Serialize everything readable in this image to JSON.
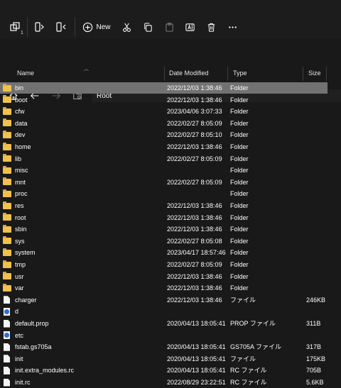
{
  "toolbar": {
    "badge_count": "1",
    "new_label": "New"
  },
  "address": {
    "path": "Root"
  },
  "columns": {
    "name": "Name",
    "date": "Date Modified",
    "type": "Type",
    "size": "Size"
  },
  "files": [
    {
      "name": "bin",
      "date": "2022/12/03 1:38:46",
      "type": "Folder",
      "size": "",
      "icon": "folder-icon",
      "selected": true
    },
    {
      "name": "boot",
      "date": "2022/12/03 1:38:46",
      "type": "Folder",
      "size": "",
      "icon": "folder-icon"
    },
    {
      "name": "cfw",
      "date": "2023/04/06 3:07:33",
      "type": "Folder",
      "size": "",
      "icon": "folder-icon"
    },
    {
      "name": "data",
      "date": "2022/02/27 8:05:09",
      "type": "Folder",
      "size": "",
      "icon": "folder-icon"
    },
    {
      "name": "dev",
      "date": "2022/02/27 8:05:10",
      "type": "Folder",
      "size": "",
      "icon": "folder-icon"
    },
    {
      "name": "home",
      "date": "2022/12/03 1:38:46",
      "type": "Folder",
      "size": "",
      "icon": "folder-icon"
    },
    {
      "name": "lib",
      "date": "2022/02/27 8:05:09",
      "type": "Folder",
      "size": "",
      "icon": "folder-icon"
    },
    {
      "name": "misc",
      "date": "",
      "type": "Folder",
      "size": "",
      "icon": "folder-icon"
    },
    {
      "name": "mnt",
      "date": "2022/02/27 8:05:09",
      "type": "Folder",
      "size": "",
      "icon": "folder-icon"
    },
    {
      "name": "proc",
      "date": "",
      "type": "Folder",
      "size": "",
      "icon": "folder-icon"
    },
    {
      "name": "res",
      "date": "2022/12/03 1:38:46",
      "type": "Folder",
      "size": "",
      "icon": "folder-icon"
    },
    {
      "name": "root",
      "date": "2022/12/03 1:38:46",
      "type": "Folder",
      "size": "",
      "icon": "folder-icon"
    },
    {
      "name": "sbin",
      "date": "2022/12/03 1:38:46",
      "type": "Folder",
      "size": "",
      "icon": "folder-icon"
    },
    {
      "name": "sys",
      "date": "2022/02/27 8:05:08",
      "type": "Folder",
      "size": "",
      "icon": "folder-icon"
    },
    {
      "name": "system",
      "date": "2023/04/17 18:57:46",
      "type": "Folder",
      "size": "",
      "icon": "folder-icon"
    },
    {
      "name": "tmp",
      "date": "2022/02/27 8:05:09",
      "type": "Folder",
      "size": "",
      "icon": "folder-icon"
    },
    {
      "name": "usr",
      "date": "2022/12/03 1:38:46",
      "type": "Folder",
      "size": "",
      "icon": "folder-icon"
    },
    {
      "name": "var",
      "date": "2022/12/03 1:38:46",
      "type": "Folder",
      "size": "",
      "icon": "folder-icon"
    },
    {
      "name": "charger",
      "date": "2022/12/03 1:38:46",
      "type": "ファイル",
      "size": "246KB",
      "icon": "file-icon"
    },
    {
      "name": "d",
      "date": "",
      "type": "",
      "size": "",
      "icon": "link-icon"
    },
    {
      "name": "default.prop",
      "date": "2020/04/13 18:05:41",
      "type": "PROP ファイル",
      "size": "311B",
      "icon": "file-icon"
    },
    {
      "name": "etc",
      "date": "",
      "type": "",
      "size": "",
      "icon": "link-icon"
    },
    {
      "name": "fstab.gs705a",
      "date": "2020/04/13 18:05:41",
      "type": "GS705A ファイル",
      "size": "317B",
      "icon": "file-icon"
    },
    {
      "name": "init",
      "date": "2020/04/13 18:05:41",
      "type": "ファイル",
      "size": "175KB",
      "icon": "file-icon"
    },
    {
      "name": "init.extra_modules.rc",
      "date": "2020/04/13 18:05:41",
      "type": "RC ファイル",
      "size": "705B",
      "icon": "file-icon"
    },
    {
      "name": "init.rc",
      "date": "2022/08/29 23:22:51",
      "type": "RC ファイル",
      "size": "5.6KB",
      "icon": "file-icon"
    }
  ]
}
